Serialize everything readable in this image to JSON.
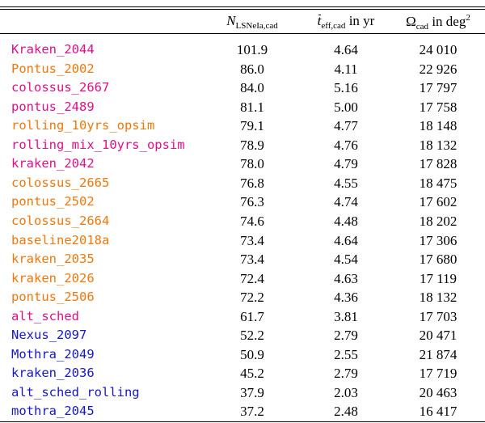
{
  "colors": {
    "magenta": "#e0108a",
    "orange": "#f0780a",
    "blue": "#1616cc"
  },
  "header": {
    "n_main": "N",
    "n_sub": "LSNeIa,cad",
    "t_main": "t",
    "t_sub": "eff,cad",
    "t_unit": " in yr",
    "o_main": "Ω",
    "o_sub": "cad",
    "o_unit": " in deg",
    "o_sup": "2"
  },
  "rows": [
    {
      "name": "Kraken_2044",
      "color": "magenta",
      "n": "101.9",
      "t": "4.64",
      "o": "24 010"
    },
    {
      "name": "Pontus_2002",
      "color": "orange",
      "n": "86.0",
      "t": "4.11",
      "o": "22 926"
    },
    {
      "name": "colossus_2667",
      "color": "magenta",
      "n": "84.0",
      "t": "5.16",
      "o": "17 797"
    },
    {
      "name": "pontus_2489",
      "color": "magenta",
      "n": "81.1",
      "t": "5.00",
      "o": "17 758"
    },
    {
      "name": "rolling_10yrs_opsim",
      "color": "orange",
      "n": "79.1",
      "t": "4.77",
      "o": "18 148"
    },
    {
      "name": "rolling_mix_10yrs_opsim",
      "color": "magenta",
      "n": "78.9",
      "t": "4.76",
      "o": "18 132"
    },
    {
      "name": "kraken_2042",
      "color": "magenta",
      "n": "78.0",
      "t": "4.79",
      "o": "17 828"
    },
    {
      "name": "colossus_2665",
      "color": "orange",
      "n": "76.8",
      "t": "4.55",
      "o": "18 475"
    },
    {
      "name": "pontus_2502",
      "color": "orange",
      "n": "76.3",
      "t": "4.74",
      "o": "17 602"
    },
    {
      "name": "colossus_2664",
      "color": "orange",
      "n": "74.6",
      "t": "4.48",
      "o": "18 202"
    },
    {
      "name": "baseline2018a",
      "color": "orange",
      "n": "73.4",
      "t": "4.64",
      "o": "17 306"
    },
    {
      "name": "kraken_2035",
      "color": "orange",
      "n": "73.4",
      "t": "4.54",
      "o": "17 680"
    },
    {
      "name": "kraken_2026",
      "color": "orange",
      "n": "72.4",
      "t": "4.63",
      "o": "17 119"
    },
    {
      "name": "pontus_2506",
      "color": "orange",
      "n": "72.2",
      "t": "4.36",
      "o": "18 132"
    },
    {
      "name": "alt_sched",
      "color": "magenta",
      "n": "61.7",
      "t": "3.81",
      "o": "17 703"
    },
    {
      "name": "Nexus_2097",
      "color": "blue",
      "n": "52.2",
      "t": "2.79",
      "o": "20 471"
    },
    {
      "name": "Mothra_2049",
      "color": "blue",
      "n": "50.9",
      "t": "2.55",
      "o": "21 874"
    },
    {
      "name": "kraken_2036",
      "color": "blue",
      "n": "45.2",
      "t": "2.79",
      "o": "17 719"
    },
    {
      "name": "alt_sched_rolling",
      "color": "blue",
      "n": "37.9",
      "t": "2.03",
      "o": "20 463"
    },
    {
      "name": "mothra_2045",
      "color": "blue",
      "n": "37.2",
      "t": "2.48",
      "o": "16 417"
    }
  ]
}
